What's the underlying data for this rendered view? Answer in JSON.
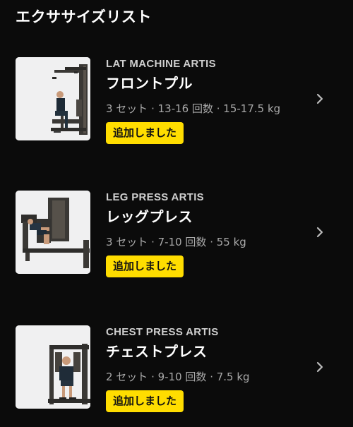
{
  "header": {
    "title": "エクササイズリスト"
  },
  "items": [
    {
      "machine": "LAT MACHINE ARTIS",
      "name": "フロントプル",
      "details": "3 セット · 13-16 回数 · 15-17.5 kg",
      "badge": "追加しました",
      "icon": "chevron-right-icon"
    },
    {
      "machine": "LEG PRESS ARTIS",
      "name": "レッグプレス",
      "details": "3 セット · 7-10 回数 · 55 kg",
      "badge": "追加しました",
      "icon": "chevron-right-icon"
    },
    {
      "machine": "CHEST PRESS ARTIS",
      "name": "チェストプレス",
      "details": "2 セット · 9-10 回数 · 7.5 kg",
      "badge": "追加しました",
      "icon": "chevron-right-icon"
    }
  ],
  "colors": {
    "background": "#0b0b0b",
    "badge": "#ffdd00",
    "badge_text": "#111111",
    "secondary_text": "#a9a9a9"
  }
}
